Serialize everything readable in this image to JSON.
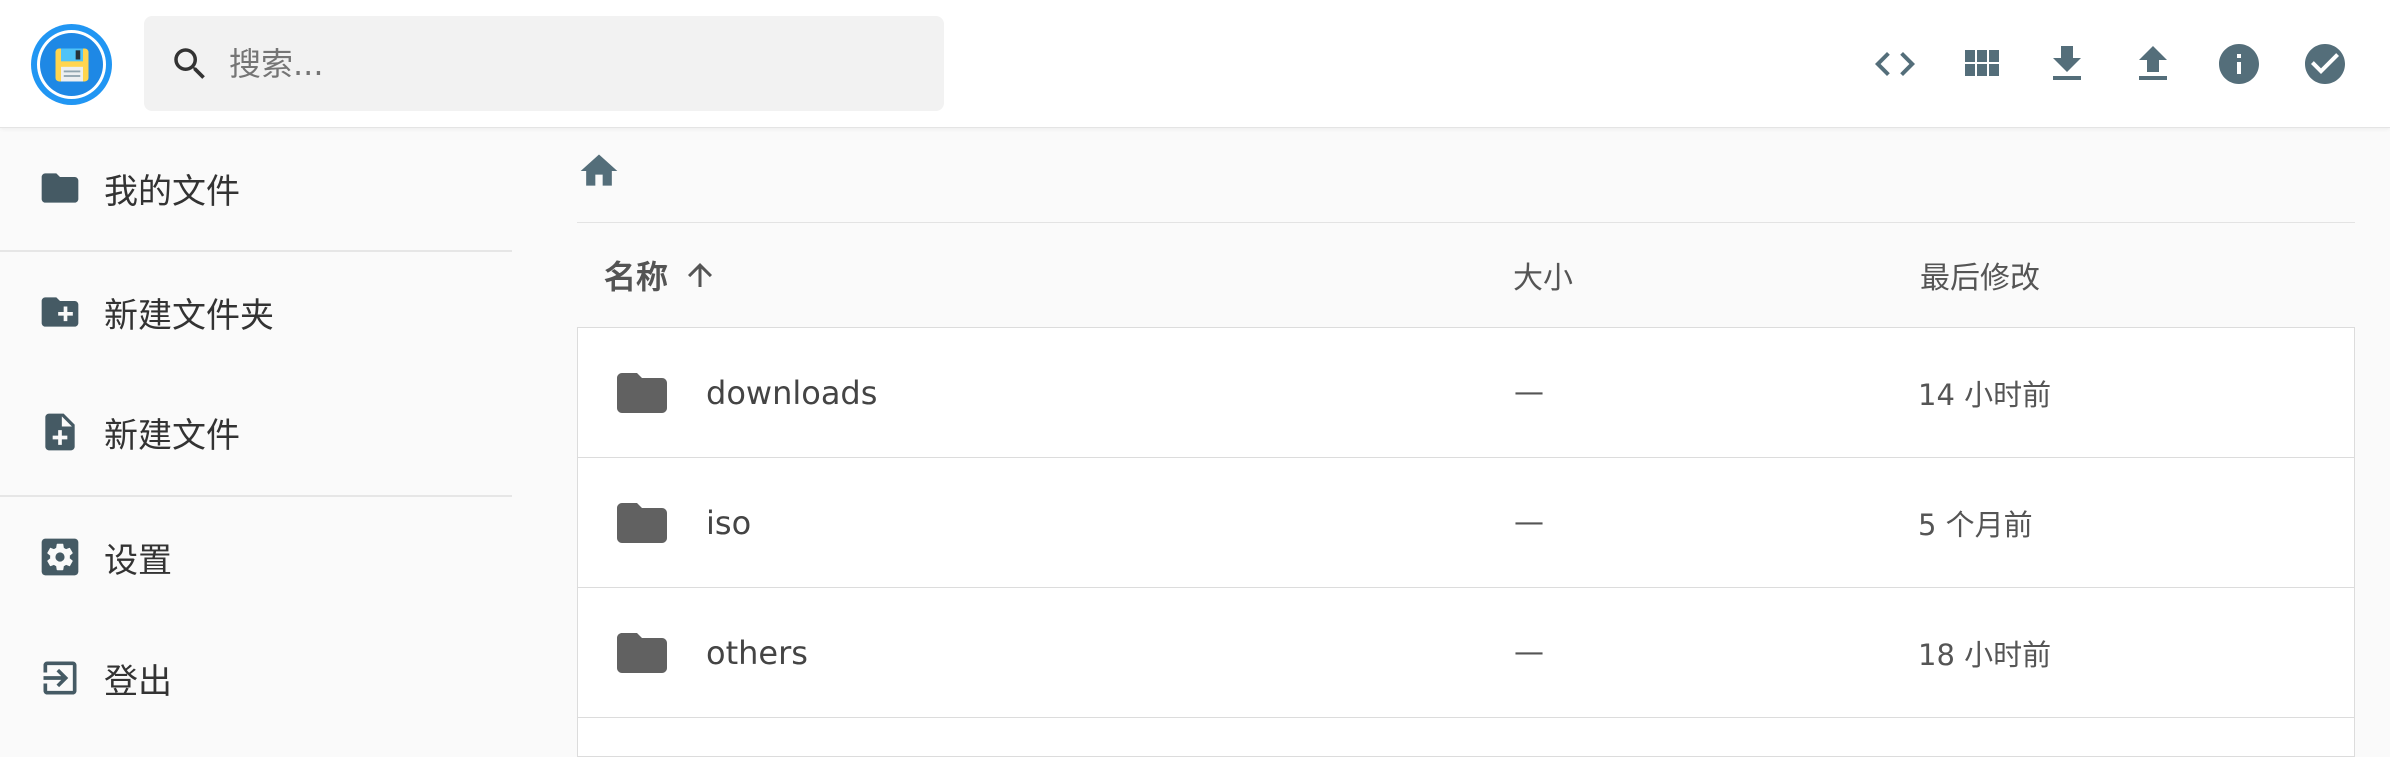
{
  "header": {
    "search_placeholder": "搜索...",
    "actions": [
      {
        "name": "code-icon"
      },
      {
        "name": "grid-view-icon"
      },
      {
        "name": "download-icon"
      },
      {
        "name": "upload-icon"
      },
      {
        "name": "info-icon"
      },
      {
        "name": "check-circle-icon"
      }
    ],
    "icon_color": "#546e7a"
  },
  "sidebar": {
    "items": [
      {
        "label": "我的文件",
        "icon": "folder-icon"
      },
      {
        "label": "新建文件夹",
        "icon": "folder-plus-icon"
      },
      {
        "label": "新建文件",
        "icon": "file-plus-icon"
      },
      {
        "label": "设置",
        "icon": "settings-icon"
      },
      {
        "label": "登出",
        "icon": "logout-icon"
      }
    ]
  },
  "breadcrumb": {
    "icon": "home-icon"
  },
  "list": {
    "columns": {
      "name": "名称",
      "size": "大小",
      "modified": "最后修改"
    },
    "sort": {
      "column": "name",
      "direction": "asc"
    },
    "rows": [
      {
        "name": "downloads",
        "size": "—",
        "modified": "14 小时前",
        "type": "folder"
      },
      {
        "name": "iso",
        "size": "—",
        "modified": "5 个月前",
        "type": "folder"
      },
      {
        "name": "others",
        "size": "—",
        "modified": "18 小时前",
        "type": "folder"
      }
    ]
  },
  "colors": {
    "accent": "#2196f3",
    "sidebar_icon": "#455a64",
    "folder_icon": "#616161"
  }
}
